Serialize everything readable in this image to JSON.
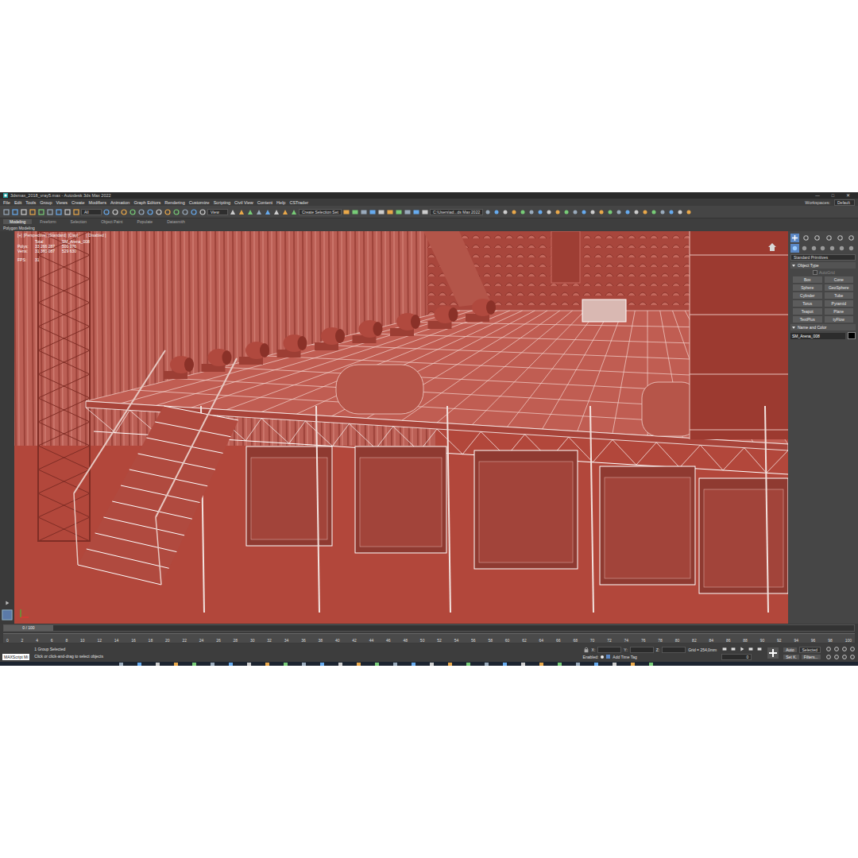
{
  "window": {
    "title": "3dsmax_2018_vray5.max - Autodesk 3ds Max 2022",
    "controls": [
      "—",
      "□",
      "✕"
    ]
  },
  "menu": [
    "File",
    "Edit",
    "Tools",
    "Group",
    "Views",
    "Create",
    "Modifiers",
    "Animation",
    "Graph Editors",
    "Rendering",
    "Customize",
    "Scripting",
    "Civil View",
    "Content",
    "Help",
    "CSTrader"
  ],
  "workspaces": {
    "label": "Workspaces:",
    "value": "Default"
  },
  "toolbar": {
    "selection_filter": "All",
    "reference_coord": "View",
    "selection_set": "Create Selection Set",
    "project_path": "C:\\Users\\ad...ds Max 2022"
  },
  "ribbon": {
    "tabs": [
      {
        "label": "Modeling",
        "selected": true
      },
      {
        "label": "Freeform",
        "selected": false
      },
      {
        "label": "Selection",
        "selected": false
      },
      {
        "label": "Object Paint",
        "selected": false
      },
      {
        "label": "Populate",
        "selected": false
      },
      {
        "label": "Datasmith",
        "selected": false
      }
    ],
    "panel": "Polygon Modeling"
  },
  "viewport": {
    "labels": [
      "[+]",
      "[Perspective]",
      "[Standard]",
      "[Clay]"
    ],
    "disabled": "[ Disabled ]",
    "stats": {
      "header": [
        "Total",
        "SM_Arena_008"
      ],
      "rows": [
        {
          "label": "Polys:",
          "total": "33 266 287",
          "selected": "500 976"
        },
        {
          "label": "Verts:",
          "total": "31 360 087",
          "selected": "529 630"
        }
      ],
      "fps_label": "FPS:",
      "fps": "31"
    }
  },
  "command_panel": {
    "category": "Standard Primitives",
    "object_type": "Object Type",
    "autogrid": {
      "label": "AutoGrid",
      "checked": false,
      "disabled": true
    },
    "buttons": [
      "Box",
      "Cone",
      "Sphere",
      "GeoSphere",
      "Cylinder",
      "Tube",
      "Torus",
      "Pyramid",
      "Teapot",
      "Plane",
      "TextPlus",
      "tyFlow"
    ],
    "name_and_color": "Name and Color",
    "object_name": "SM_Arena_008"
  },
  "timeline": {
    "frame": "0 / 100",
    "level": 0,
    "ticks": [
      "0",
      "2",
      "4",
      "6",
      "8",
      "10",
      "12",
      "14",
      "16",
      "18",
      "20",
      "22",
      "24",
      "26",
      "28",
      "30",
      "32",
      "34",
      "36",
      "38",
      "40",
      "42",
      "44",
      "46",
      "48",
      "50",
      "52",
      "54",
      "56",
      "58",
      "60",
      "62",
      "64",
      "66",
      "68",
      "70",
      "72",
      "74",
      "76",
      "78",
      "80",
      "82",
      "84",
      "86",
      "88",
      "90",
      "92",
      "94",
      "96",
      "98",
      "100"
    ]
  },
  "status_bar": {
    "script_box": "MAXScript Mi",
    "selection": "1 Group Selected",
    "prompt": "Click or click-and-drag to select objects",
    "coords": [
      {
        "label": "X:",
        "value": ""
      },
      {
        "label": "Y:",
        "value": ""
      },
      {
        "label": "Z:",
        "value": ""
      }
    ],
    "grid": "Grid = 254,0mm",
    "enabled": "Enabled:",
    "time_tag": "Add Time Tag",
    "auto_key": "Auto",
    "key_filter": "Selected",
    "set_key": "Set K.",
    "filters": "Filters...",
    "frame_field": "0"
  }
}
